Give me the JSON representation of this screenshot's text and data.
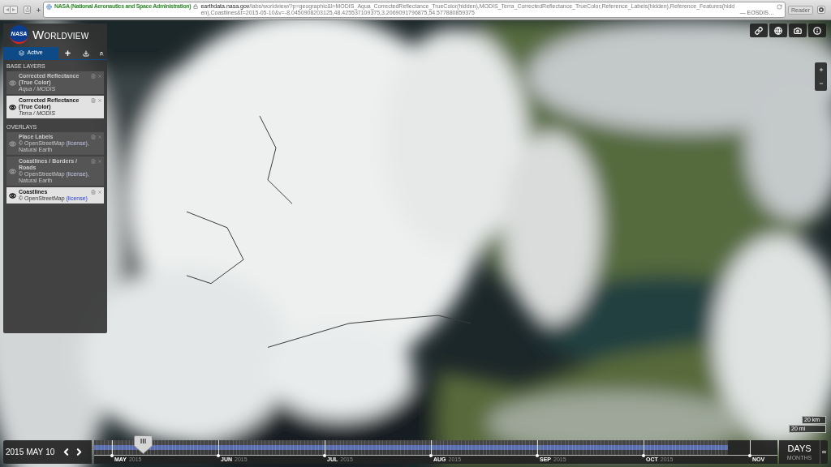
{
  "browser": {
    "site_identity": "NASA (National Aeronautics and Space Administration)",
    "url": "**earthdata.nasa.gov**/labs/worldview/?p=geographic&l=MODIS_Aqua_CorrectedReflectance_TrueColor(hidden),MODIS_Terra_CorrectedReflectance_TrueColor,Reference_Labels(hidden),Reference_Features(hidden),Coastlines&t=2015-05-10&v=-8.0450908203125,48.425537109375,3.2069091796875,54.577880859375",
    "page_title": "— EOSDIS…",
    "reader_button": "Reader"
  },
  "app": {
    "logo": "NASA",
    "title": "WORLDVIEW"
  },
  "sidebar": {
    "tabs": [
      {
        "label": "Active",
        "selected": true
      }
    ],
    "sections": [
      {
        "heading": "BASE LAYERS",
        "kind": "base",
        "layers": [
          {
            "title": "Corrected Reflectance (True Color)",
            "source": "Aqua / MODIS",
            "visible": false
          },
          {
            "title": "Corrected Reflectance (True Color)",
            "source": "Terra / MODIS",
            "visible": true
          }
        ]
      },
      {
        "heading": "OVERLAYS",
        "kind": "overlay",
        "layers": [
          {
            "title": "Place Labels",
            "source": "© OpenStreetMap",
            "link": "(license)",
            "source_end": ", Natural Earth",
            "visible": false
          },
          {
            "title": "Coastlines / Borders / Roads",
            "source": "© OpenStreetMap",
            "link": "(license)",
            "source_end": ", Natural Earth",
            "visible": false
          },
          {
            "title": "Coastlines",
            "source": "© OpenStreetMap",
            "link": "(license)",
            "visible": true
          }
        ]
      }
    ]
  },
  "map": {
    "scale_bars": [
      "20 km",
      "20 mi"
    ]
  },
  "timeline": {
    "date": {
      "year": "2015",
      "month": "MAY",
      "day": "10"
    },
    "level": 0.072,
    "coverage": {
      "level": 0.927
    },
    "months": [
      {
        "month": "MAY",
        "year": "2015"
      },
      {
        "month": "JUN",
        "year": "2015"
      },
      {
        "month": "JUL",
        "year": "2015"
      },
      {
        "month": "AUG",
        "year": "2015"
      },
      {
        "month": "SEP",
        "year": "2015"
      },
      {
        "month": "OCT",
        "year": "2015"
      },
      {
        "month": "NOV"
      }
    ],
    "zoom_levels": [
      {
        "label": "DAYS",
        "selected": true
      },
      {
        "label": "MONTHS",
        "selected": false
      }
    ]
  }
}
